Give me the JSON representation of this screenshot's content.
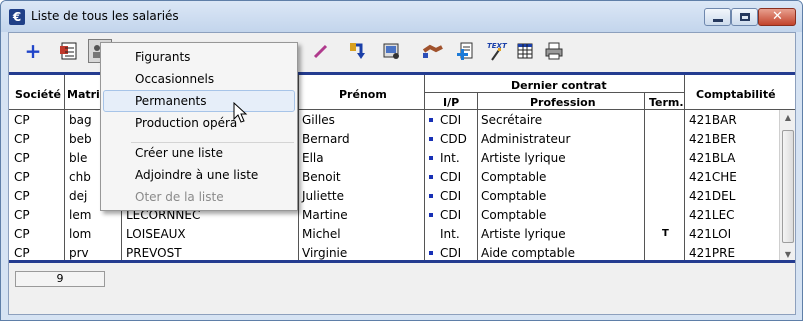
{
  "window": {
    "title": "Liste de tous les salariés",
    "app_icon_glyph": "€"
  },
  "toolbar": {
    "icons": [
      "add-icon",
      "list-icon",
      "people-icon",
      "calendar-icon",
      "clock-icon",
      "card-icon",
      "flag-icon",
      "stamp-icon",
      "pen-icon",
      "refresh-arrow-icon",
      "photo-icon",
      "handshake-icon",
      "new-document-icon",
      "text-icon",
      "table-icon",
      "printer-icon"
    ]
  },
  "table": {
    "headers": {
      "societe": "Société",
      "matricule": "Matric",
      "prenom": "Prénom",
      "dernier_contrat": "Dernier contrat",
      "ip": "I/P",
      "profession": "Profession",
      "term": "Term.",
      "comptabilite": "Comptabilité"
    },
    "rows": [
      {
        "societe": "CP",
        "matricule": "bag",
        "nom": "",
        "prenom": "Gilles",
        "ip": "CDI",
        "bullet": true,
        "profession": "Secrétaire",
        "term": "",
        "compta": "421BAR"
      },
      {
        "societe": "CP",
        "matricule": "beb",
        "nom": "",
        "prenom": "Bernard",
        "ip": "CDD",
        "bullet": true,
        "profession": "Administrateur",
        "term": "",
        "compta": "421BER"
      },
      {
        "societe": "CP",
        "matricule": "ble",
        "nom": "",
        "prenom": "Ella",
        "ip": "Int.",
        "bullet": true,
        "profession": "Artiste lyrique",
        "term": "",
        "compta": "421BLA"
      },
      {
        "societe": "CP",
        "matricule": "chb",
        "nom": "",
        "prenom": "Benoit",
        "ip": "CDI",
        "bullet": true,
        "profession": "Comptable",
        "term": "",
        "compta": "421CHE"
      },
      {
        "societe": "CP",
        "matricule": "dej",
        "nom": "",
        "prenom": "Juliette",
        "ip": "CDI",
        "bullet": true,
        "profession": "Comptable",
        "term": "",
        "compta": "421DEL"
      },
      {
        "societe": "CP",
        "matricule": "lem",
        "nom": "LECORNNEC",
        "prenom": "Martine",
        "ip": "CDI",
        "bullet": true,
        "profession": "Comptable",
        "term": "",
        "compta": "421LEC"
      },
      {
        "societe": "CP",
        "matricule": "lom",
        "nom": "LOISEAUX",
        "prenom": "Michel",
        "ip": "Int.",
        "bullet": false,
        "profession": "Artiste lyrique",
        "term": "T",
        "compta": "421LOI"
      },
      {
        "societe": "CP",
        "matricule": "prv",
        "nom": "PREVOST",
        "prenom": "Virginie",
        "ip": "CDI",
        "bullet": true,
        "profession": "Aide comptable",
        "term": "",
        "compta": "421PRE"
      }
    ]
  },
  "status": {
    "count": "9"
  },
  "context_menu": {
    "items": [
      {
        "label": "Figurants",
        "highlighted": false,
        "disabled": false
      },
      {
        "label": "Occasionnels",
        "highlighted": false,
        "disabled": false
      },
      {
        "label": "Permanents",
        "highlighted": true,
        "disabled": false
      },
      {
        "label": "Production opéra",
        "highlighted": false,
        "disabled": false
      },
      {
        "label": "Créer une liste",
        "highlighted": false,
        "disabled": false
      },
      {
        "label": "Adjoindre à une liste",
        "highlighted": false,
        "disabled": false
      },
      {
        "label": "Oter de la liste",
        "highlighted": false,
        "disabled": true
      }
    ]
  },
  "colors": {
    "accent": "#243c90",
    "bullet": "#1730b5",
    "menu_highlight": "#e6eef9"
  }
}
